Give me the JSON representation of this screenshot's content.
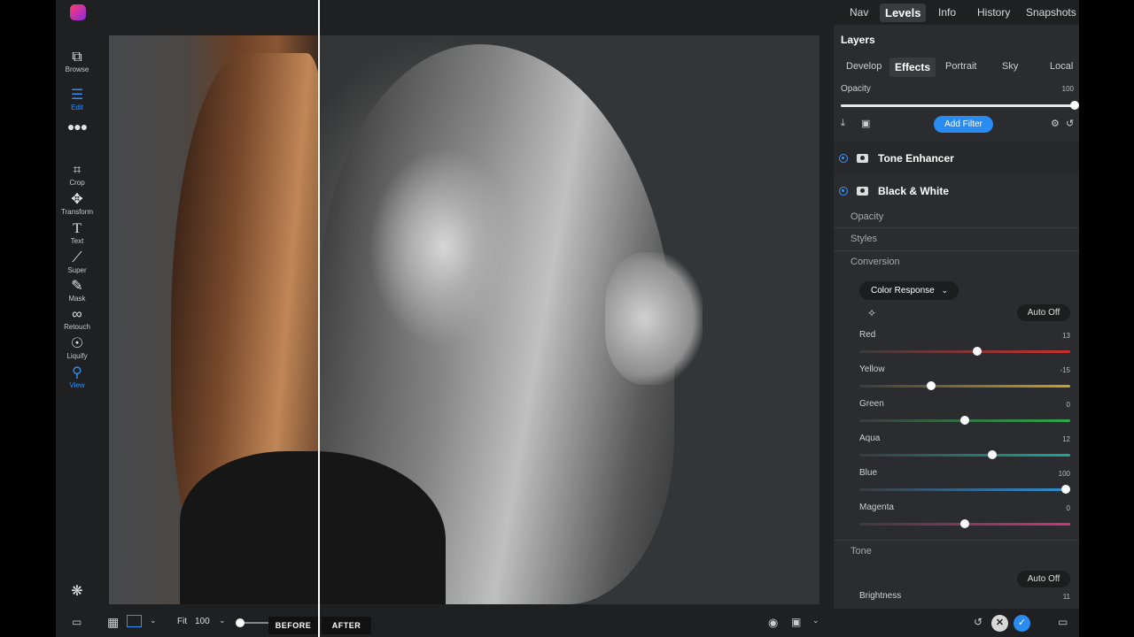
{
  "toolbar": {
    "tools": [
      {
        "label": "Browse",
        "icon": "browse-icon"
      },
      {
        "label": "Edit",
        "icon": "sliders-icon"
      },
      {
        "label": "",
        "icon": "more-icon"
      },
      {
        "label": "Crop",
        "icon": "crop-icon"
      },
      {
        "label": "Transform",
        "icon": "move-icon"
      },
      {
        "label": "Text",
        "icon": "text-icon"
      },
      {
        "label": "Super",
        "icon": "super-brush-icon"
      },
      {
        "label": "Mask",
        "icon": "mask-brush-icon"
      },
      {
        "label": "Retouch",
        "icon": "retouch-icon"
      },
      {
        "label": "Liquify",
        "icon": "liquify-icon"
      },
      {
        "label": "View",
        "icon": "view-zoom-icon"
      }
    ]
  },
  "top_tabs": [
    "Nav",
    "Levels",
    "Info",
    "History",
    "Snapshots"
  ],
  "active_top_tab": "Levels",
  "layers_title": "Layers",
  "sub_tabs": [
    "Develop",
    "Effects",
    "Portrait",
    "Sky",
    "Local"
  ],
  "active_sub_tab": "Effects",
  "opacity": {
    "label": "Opacity",
    "value": "100"
  },
  "add_filter_label": "Add Filter",
  "filters": [
    {
      "name": "Tone Enhancer"
    },
    {
      "name": "Black & White"
    }
  ],
  "sections": {
    "opacity": "Opacity",
    "styles": "Styles",
    "conversion": "Conversion",
    "tone": "Tone"
  },
  "color_response_label": "Color Response",
  "auto_off_label": "Auto Off",
  "sliders": [
    {
      "name": "Red",
      "value": "13",
      "level": 0.56,
      "color": "#c9302c"
    },
    {
      "name": "Yellow",
      "value": "-15",
      "level": 0.34,
      "color": "#c9a227"
    },
    {
      "name": "Green",
      "value": "0",
      "level": 0.5,
      "color": "#2fa84a"
    },
    {
      "name": "Aqua",
      "value": "12",
      "level": 0.63,
      "color": "#1aa89a"
    },
    {
      "name": "Blue",
      "value": "100",
      "level": 0.98,
      "color": "#2d8fd6"
    },
    {
      "name": "Magenta",
      "value": "0",
      "level": 0.5,
      "color": "#d0357a"
    }
  ],
  "tone_slider": {
    "name": "Brightness",
    "value": "11"
  },
  "bottom": {
    "fit_label": "Fit",
    "zoom_value": "100",
    "before_label": "BEFORE",
    "after_label": "AFTER"
  },
  "colors": {
    "accent": "#2a8cf0",
    "panel": "#2b2c2f",
    "background": "#1f2022"
  }
}
